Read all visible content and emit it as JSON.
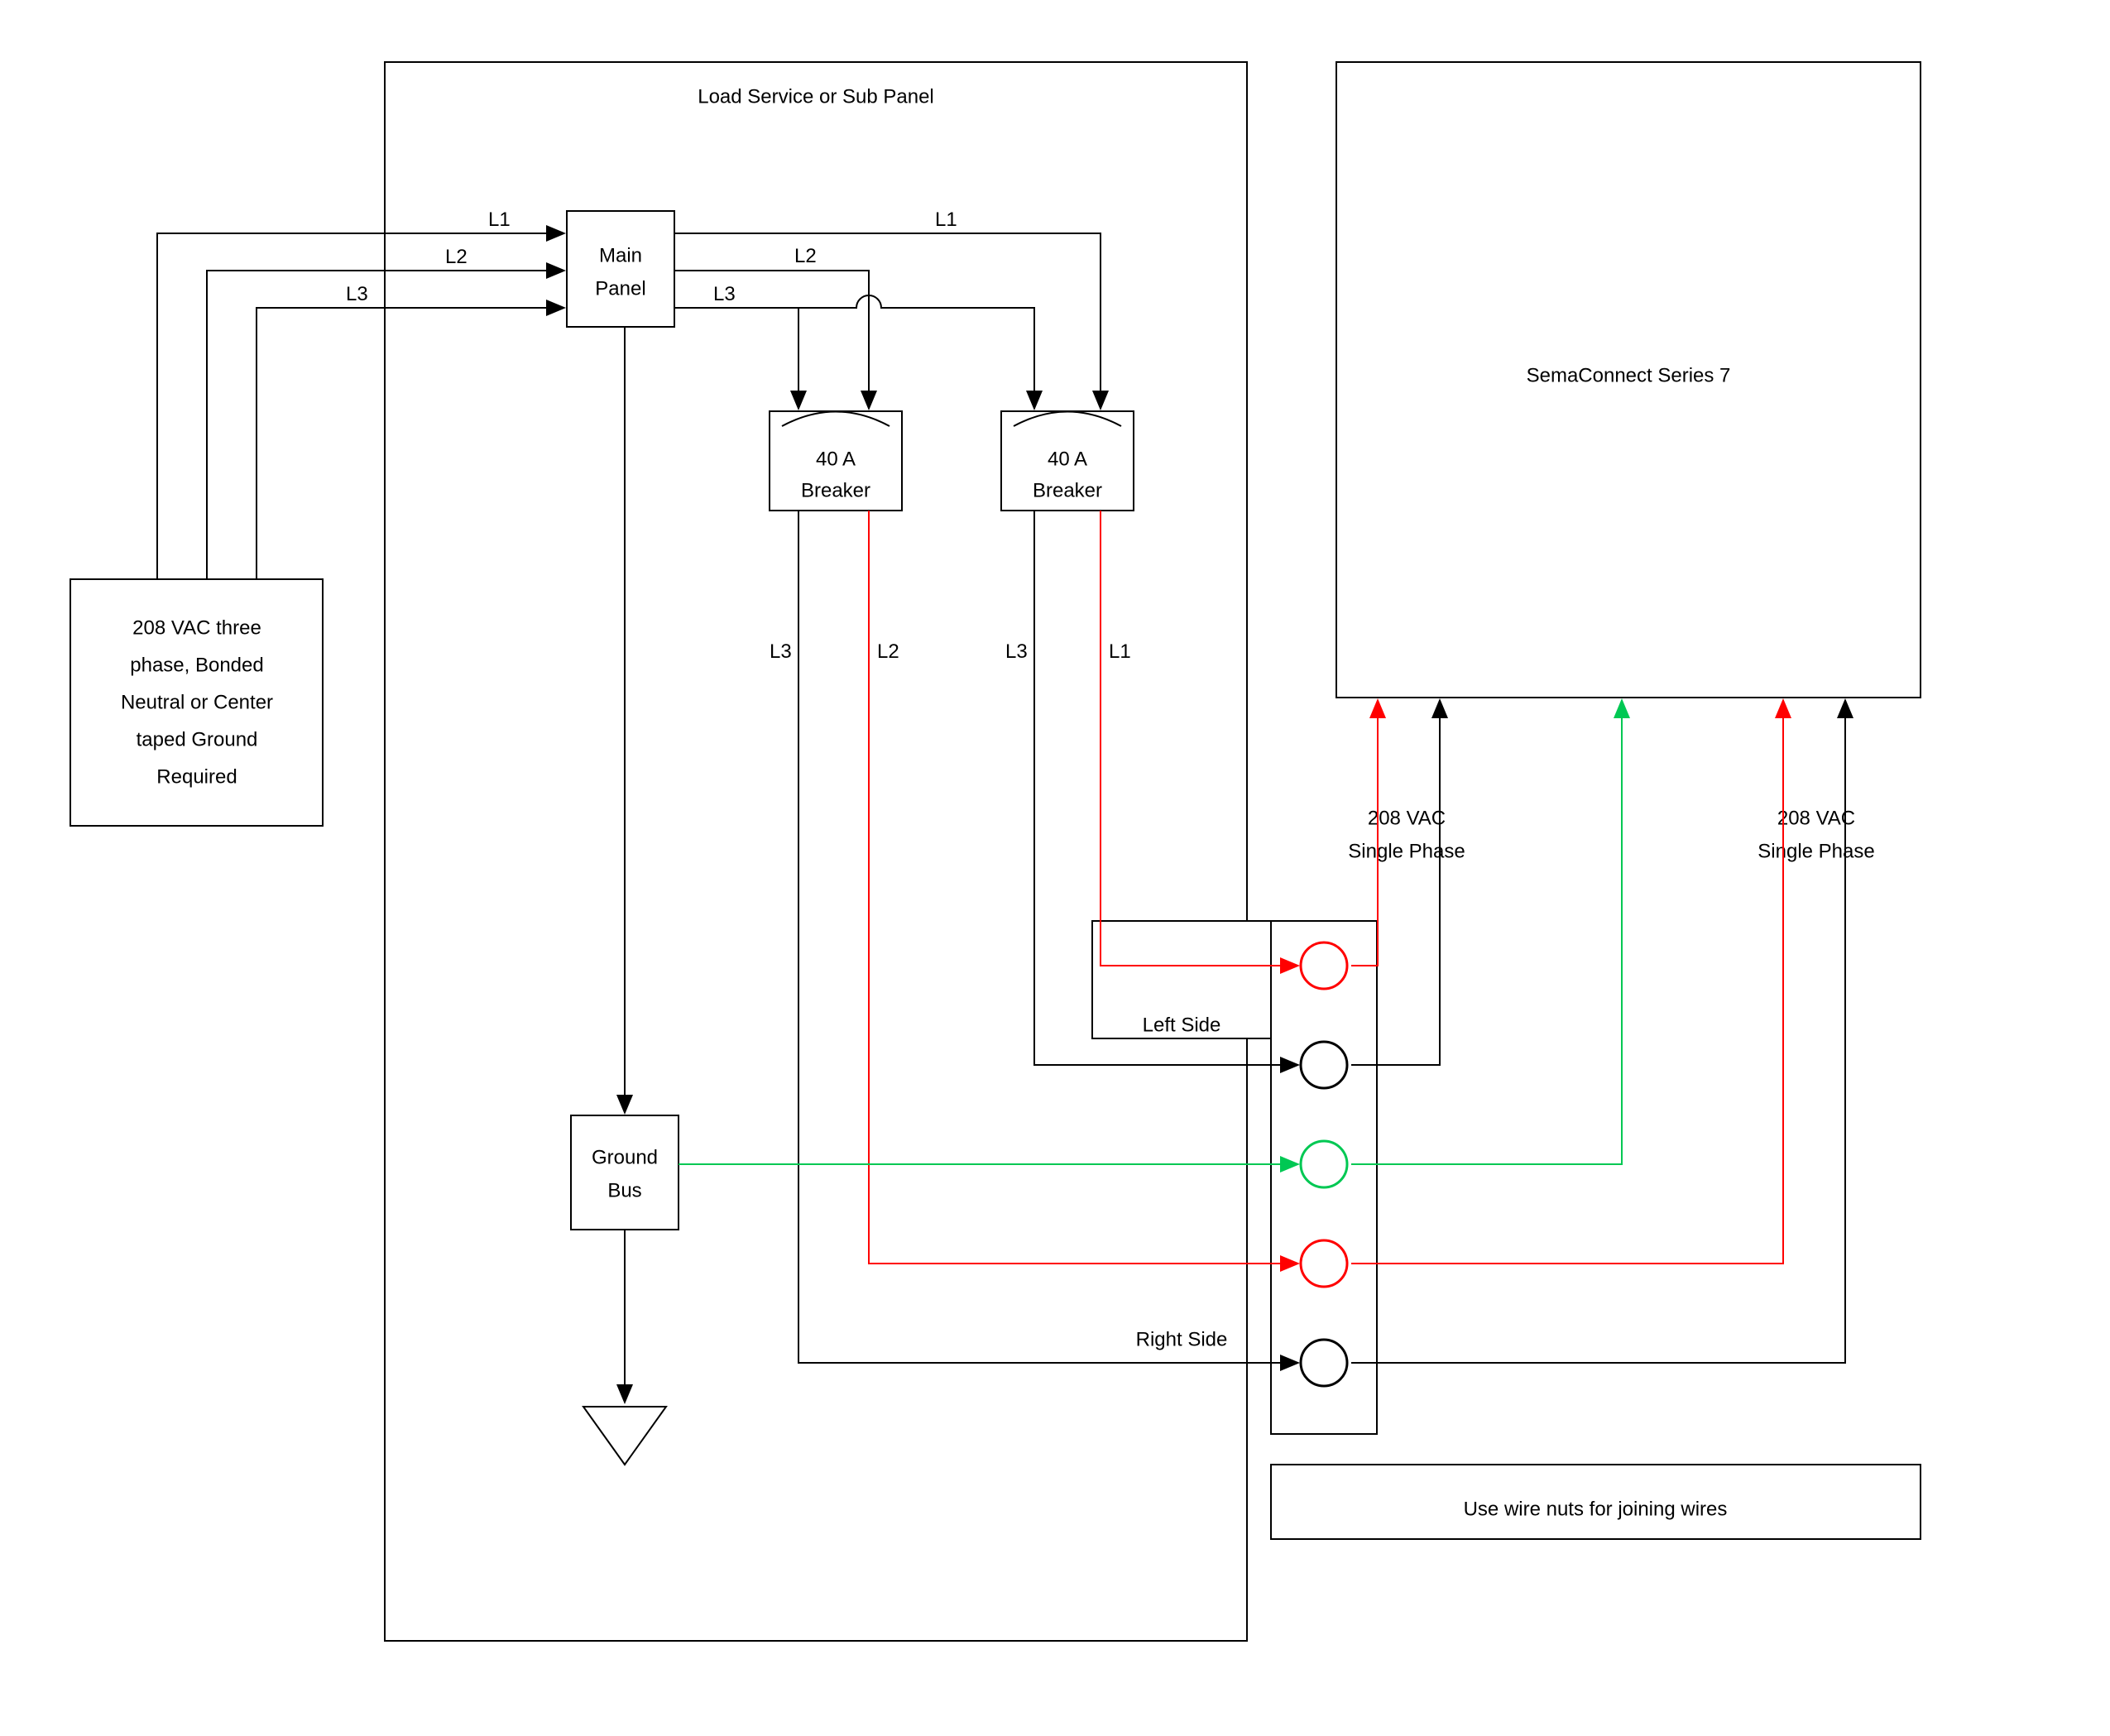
{
  "diagram": {
    "supply": {
      "line1": "208 VAC three",
      "line2": "phase, Bonded",
      "line3": "Neutral or Center",
      "line4": "taped Ground",
      "line5": "Required"
    },
    "panel_title": "Load Service or Sub Panel",
    "main_panel": {
      "line1": "Main",
      "line2": "Panel"
    },
    "ground_bus": {
      "line1": "Ground",
      "line2": "Bus"
    },
    "breaker_left": {
      "line1": "40 A",
      "line2": "Breaker"
    },
    "breaker_right": {
      "line1": "40 A",
      "line2": "Breaker"
    },
    "sema": "SemaConnect Series 7",
    "phase_left": {
      "line1": "208 VAC",
      "line2": "Single Phase"
    },
    "phase_right": {
      "line1": "208 VAC",
      "line2": "Single Phase"
    },
    "left_side": "Left Side",
    "right_side": "Right Side",
    "wire_nuts": "Use wire nuts for joining wires",
    "labels": {
      "L1": "L1",
      "L2": "L2",
      "L3": "L3"
    }
  },
  "colors": {
    "black": "#000000",
    "red": "#ff0000",
    "green": "#00c853"
  }
}
